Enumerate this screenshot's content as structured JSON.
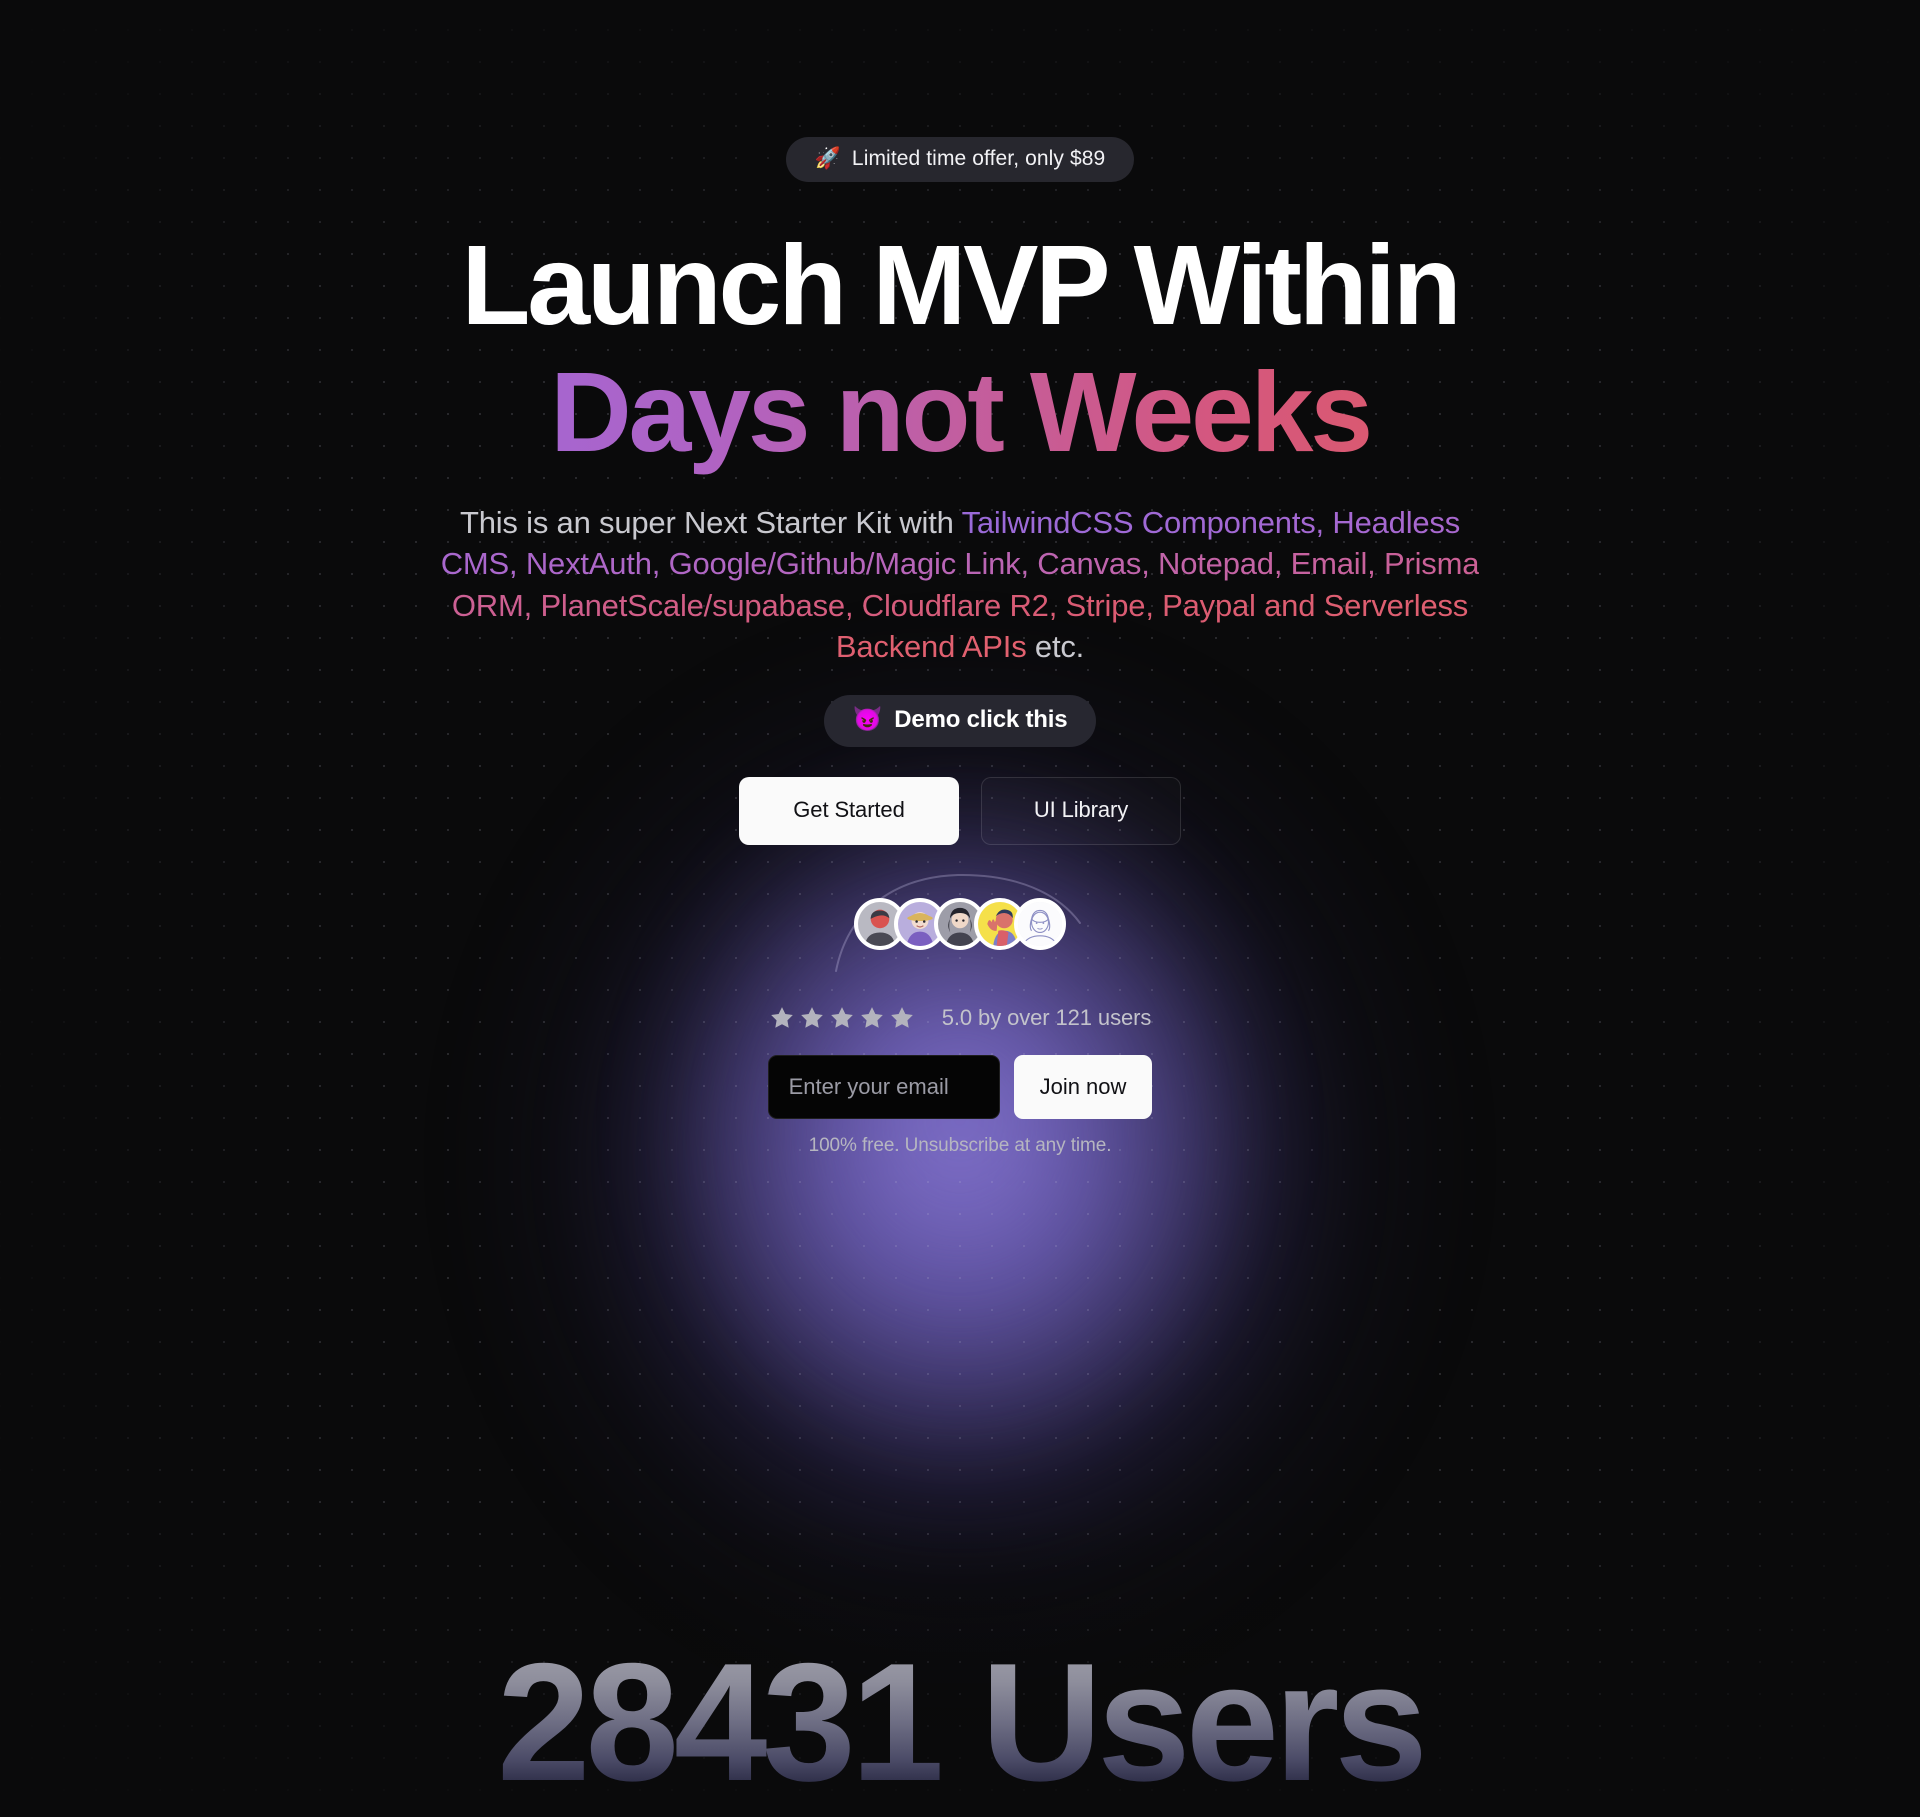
{
  "promo": {
    "emoji": "🚀",
    "emoji_name": "rocket-emoji",
    "text": "Limited time offer, only $89"
  },
  "headline": {
    "line1": "Launch MVP Within",
    "line2": "Days not Weeks",
    "gradient_from": "#9a63d8",
    "gradient_to": "#e0646f"
  },
  "subtitle": {
    "lead": "This is an super Next Starter Kit with ",
    "gradient_text": "TailwindCSS Components, Headless CMS, NextAuth, Google/Github/Magic Link, Canvas, Notepad, Email, Prisma ORM, PlanetScale/supabase, Cloudflare R2, Stripe, Paypal and Serverless Backend APIs",
    "tail": " etc."
  },
  "demo": {
    "emoji": "😈",
    "emoji_name": "smiling-imp-emoji",
    "label": "Demo click this"
  },
  "cta": {
    "primary_label": "Get Started",
    "secondary_label": "UI Library"
  },
  "social_proof": {
    "avatar_count": 5,
    "stars": 5,
    "rating_text": "5.0 by over 121 users"
  },
  "signup": {
    "email_placeholder": "Enter your email",
    "email_value": "",
    "submit_label": "Join now",
    "note": "100% free. Unsubscribe at any time."
  },
  "stats": {
    "users_line": "28431 Users",
    "count": 28431
  }
}
